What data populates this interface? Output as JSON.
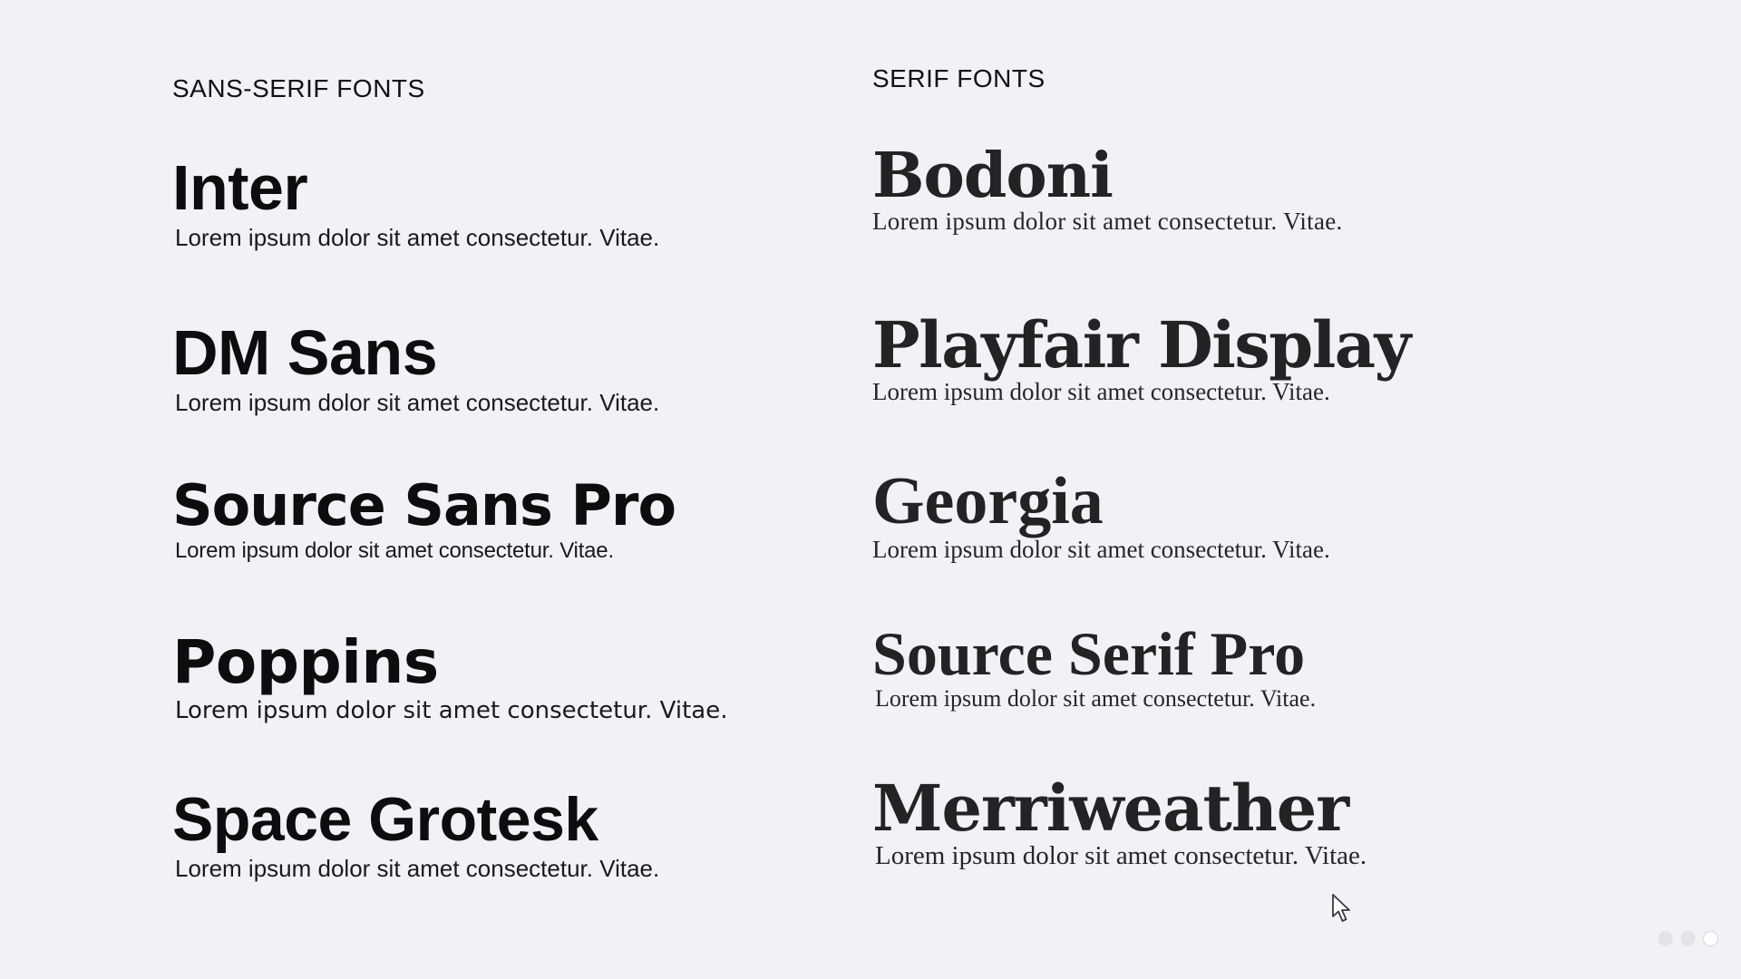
{
  "sans": {
    "heading": "SANS-SERIF FONTS",
    "fonts": [
      {
        "name": "Inter",
        "sample": "Lorem ipsum dolor sit amet consectetur. Vitae."
      },
      {
        "name": "DM Sans",
        "sample": "Lorem ipsum dolor sit amet consectetur. Vitae."
      },
      {
        "name": "Source Sans Pro",
        "sample": "Lorem ipsum dolor sit amet consectetur. Vitae."
      },
      {
        "name": "Poppins",
        "sample": "Lorem ipsum dolor sit amet consectetur. Vitae."
      },
      {
        "name": "Space Grotesk",
        "sample": "Lorem ipsum dolor sit amet consectetur. Vitae."
      }
    ]
  },
  "serif": {
    "heading": "SERIF FONTS",
    "fonts": [
      {
        "name": "Bodoni",
        "sample": "Lorem ipsum dolor sit amet consectetur. Vitae."
      },
      {
        "name": "Playfair Display",
        "sample": "Lorem ipsum dolor sit amet consectetur. Vitae."
      },
      {
        "name": "Georgia",
        "sample": "Lorem ipsum dolor sit amet consectetur. Vitae."
      },
      {
        "name": "Source Serif Pro",
        "sample": "Lorem ipsum dolor sit amet consectetur. Vitae."
      },
      {
        "name": "Merriweather",
        "sample": "Lorem ipsum dolor sit amet consectetur. Vitae."
      }
    ]
  },
  "pager": {
    "total": 3,
    "active_index": 2
  },
  "colors": {
    "background": "#f2f2f6",
    "text_primary": "#0e0e10",
    "text_serif": "#232326"
  },
  "icons": {
    "cursor": "pointer-arrow-icon"
  }
}
